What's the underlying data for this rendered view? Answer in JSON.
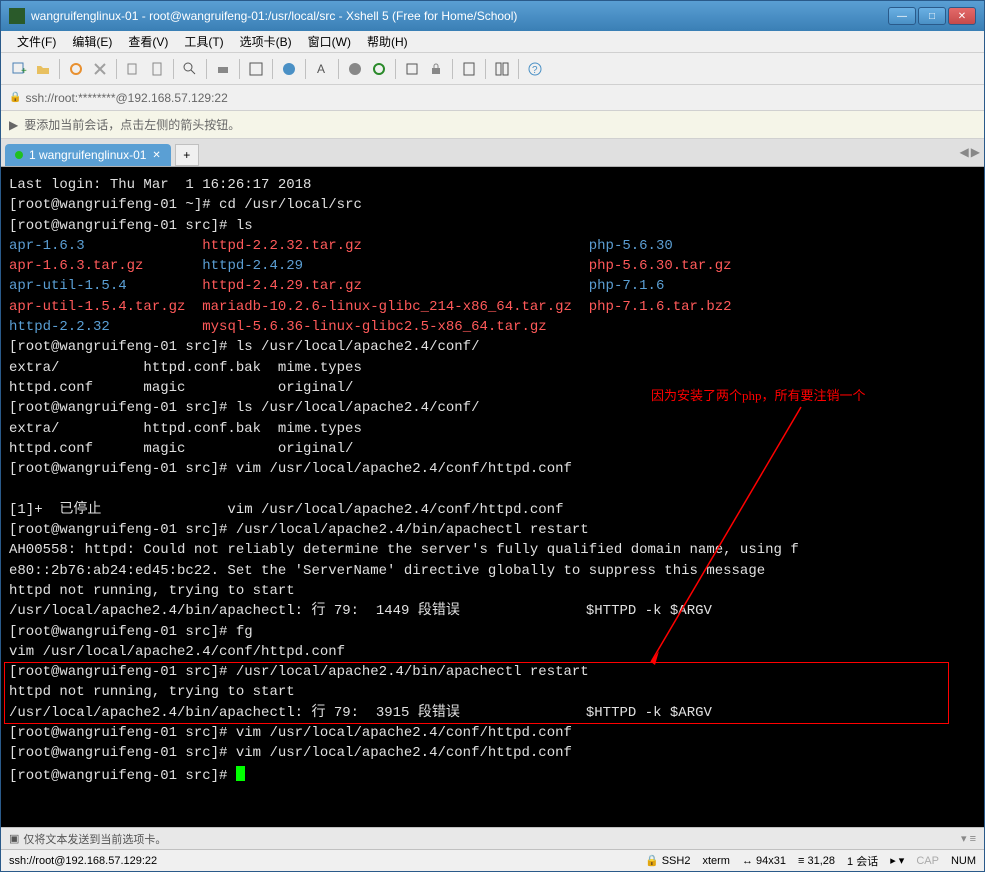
{
  "titlebar": {
    "text": "wangruifenglinux-01 - root@wangruifeng-01:/usr/local/src - Xshell 5 (Free for Home/School)"
  },
  "menubar": {
    "items": [
      "文件(F)",
      "编辑(E)",
      "查看(V)",
      "工具(T)",
      "选项卡(B)",
      "窗口(W)",
      "帮助(H)"
    ]
  },
  "addressbar": {
    "text": "ssh://root:********@192.168.57.129:22"
  },
  "infobar": {
    "text": "要添加当前会话，点击左侧的箭头按钮。"
  },
  "tabs": {
    "active": "1 wangruifenglinux-01"
  },
  "terminal": {
    "line1": "Last login: Thu Mar  1 16:26:17 2018",
    "prompt1": "[root@wangruifeng-01 ~]# ",
    "cmd1": "cd /usr/local/src",
    "prompt2": "[root@wangruifeng-01 src]# ",
    "cmd2": "ls",
    "f_apr163": "apr-1.6.3",
    "f_httpd2232tar": "httpd-2.2.32.tar.gz",
    "f_php5630": "php-5.6.30",
    "f_apr163tar": "apr-1.6.3.tar.gz",
    "f_httpd2429": "httpd-2.4.29",
    "f_php5630tar": "php-5.6.30.tar.gz",
    "f_aprutil154": "apr-util-1.5.4",
    "f_httpd2429tar": "httpd-2.4.29.tar.gz",
    "f_php716": "php-7.1.6",
    "f_aprutil154tar": "apr-util-1.5.4.tar.gz",
    "f_mariadb": "mariadb-10.2.6-linux-glibc_214-x86_64.tar.gz",
    "f_php716tar": "php-7.1.6.tar.bz2",
    "f_httpd2232": "httpd-2.2.32",
    "f_mysql": "mysql-5.6.36-linux-glibc2.5-x86_64.tar.gz",
    "cmd3": "ls /usr/local/apache2.4/conf/",
    "ls_out1": "extra/          httpd.conf.bak  mime.types",
    "ls_out2": "httpd.conf      magic           original/",
    "cmd4": "vim /usr/local/apache2.4/conf/httpd.conf",
    "stopped": "[1]+  已停止               vim /usr/local/apache2.4/conf/httpd.conf",
    "cmd5": "/usr/local/apache2.4/bin/apachectl restart",
    "err1": "AH00558: httpd: Could not reliably determine the server's fully qualified domain name, using f",
    "err2": "e80::2b76:ab24:ed45:bc22. Set the 'ServerName' directive globally to suppress this message",
    "err3": "httpd not running, trying to start",
    "err4": "/usr/local/apache2.4/bin/apachectl: 行 79:  1449 段错误               $HTTPD -k $ARGV",
    "cmd6": "fg",
    "fg_out": "vim /usr/local/apache2.4/conf/httpd.conf",
    "err5": "/usr/local/apache2.4/bin/apachectl: 行 79:  3915 段错误               $HTTPD -k $ARGV",
    "annotation": "因为安装了两个php，所有要注销一个"
  },
  "statusbar": {
    "send_text": "仅将文本发送到当前选项卡。",
    "conn": "ssh://root@192.168.57.129:22",
    "ssh": "SSH2",
    "term": "xterm",
    "size": "94x31",
    "pos": "31,28",
    "sessions": "1 会话",
    "cap": "CAP",
    "num": "NUM"
  }
}
